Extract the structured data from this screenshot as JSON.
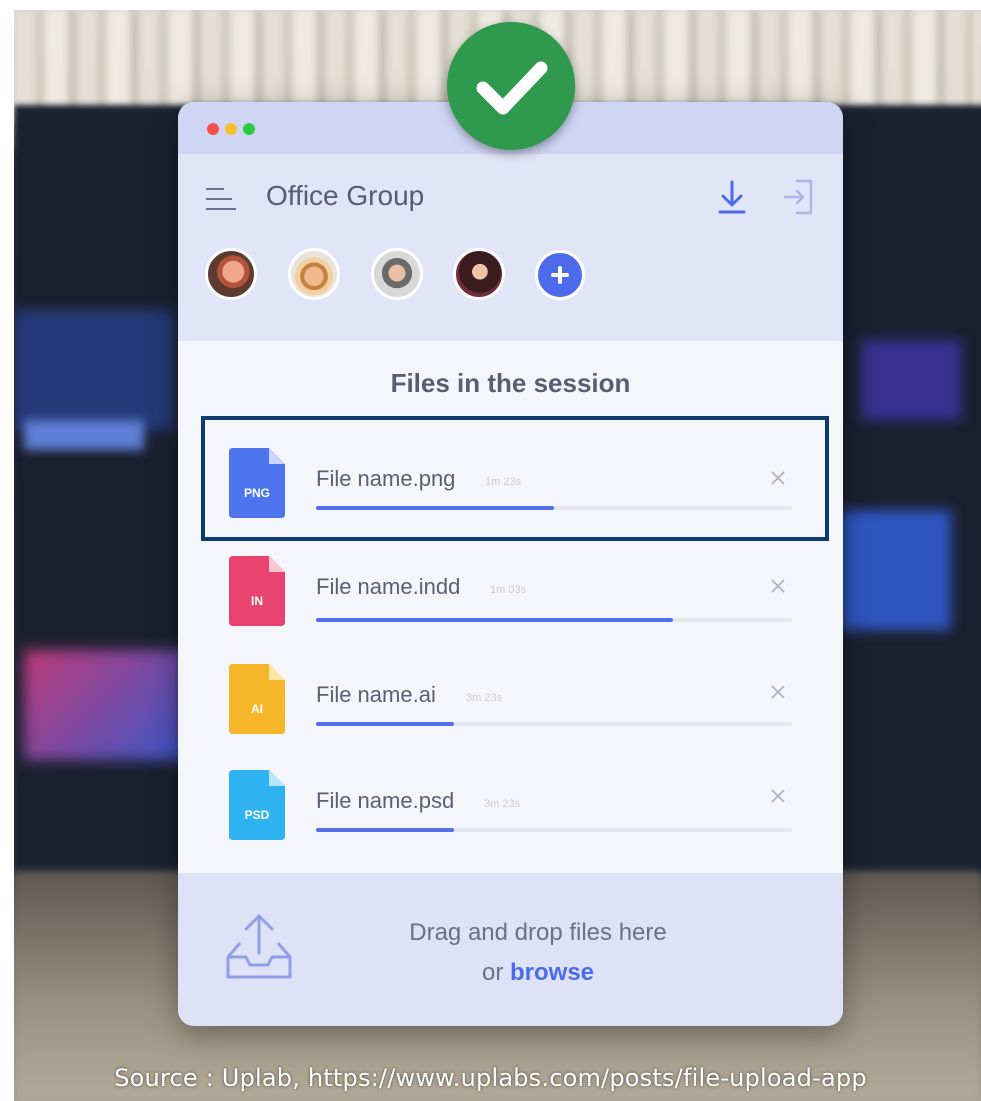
{
  "window": {
    "title": "Office Group",
    "section_title": "Files in the session"
  },
  "members": [
    {
      "name": "member-avatar-1"
    },
    {
      "name": "member-avatar-2"
    },
    {
      "name": "member-avatar-3"
    },
    {
      "name": "member-avatar-4"
    }
  ],
  "files": [
    {
      "name": "File name.png",
      "time": "1m 23s",
      "type_badge": "PNG",
      "color": "#4e74ee",
      "progress": 0.5
    },
    {
      "name": "File name.indd",
      "time": "1m 03s",
      "type_badge": "IN",
      "color": "#e8446f",
      "progress": 0.75
    },
    {
      "name": "File name.ai",
      "time": "3m 23s",
      "type_badge": "AI",
      "color": "#f6b62a",
      "progress": 0.29
    },
    {
      "name": "File name.psd",
      "time": "3m 23s",
      "type_badge": "PSD",
      "color": "#2fb2f0",
      "progress": 0.29
    }
  ],
  "upload": {
    "line1": "Drag and drop files here",
    "line2_prefix": "or ",
    "browse_label": "browse"
  },
  "caption": "Source : Uplab, https://www.uplabs.com/posts/file-upload-app",
  "colors": {
    "accent": "#4b6bea",
    "success": "#2f9a4d",
    "selection_outline": "#0d3a6f"
  }
}
